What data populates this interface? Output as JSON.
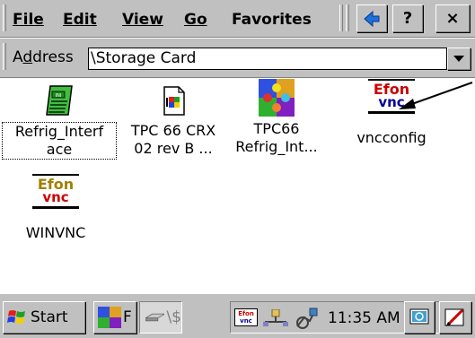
{
  "menu": {
    "file": "File",
    "edit": "Edit",
    "view": "View",
    "go": "Go",
    "favorites": "Favorites"
  },
  "toolbar": {
    "back_icon": "back-arrow-icon",
    "help": "?",
    "close": "×"
  },
  "address": {
    "label": "Address",
    "value": "\\Storage Card"
  },
  "files": [
    {
      "line1": "Refrig_Interf",
      "line2": "ace",
      "icon": "ini-notepad-icon"
    },
    {
      "line1": "TPC 66 CRX",
      "line2": "02 rev B ...",
      "icon": "windows-doc-icon"
    },
    {
      "line1": "TPC66",
      "line2": "Refrig_Int...",
      "icon": "puzzle-app-icon"
    },
    {
      "line1": "vncconfig",
      "line2": "",
      "icon": "efon-vnc-icon"
    },
    {
      "line1": "WINVNC",
      "line2": "",
      "icon": "efon-vnc-icon"
    }
  ],
  "efon_logo": {
    "top": "Efon",
    "bottom": "vnc",
    "top_color": "#cc0000",
    "bottom_color": "#000099"
  },
  "taskbar": {
    "start": "Start",
    "task1": "F",
    "task2": "\\$",
    "tray_efon_top": "Efon",
    "tray_efon_bottom": "vnc",
    "clock": "11:35 AM"
  },
  "colors": {
    "chrome": "#c0c0c0",
    "accent_blue": "#0000a8"
  }
}
